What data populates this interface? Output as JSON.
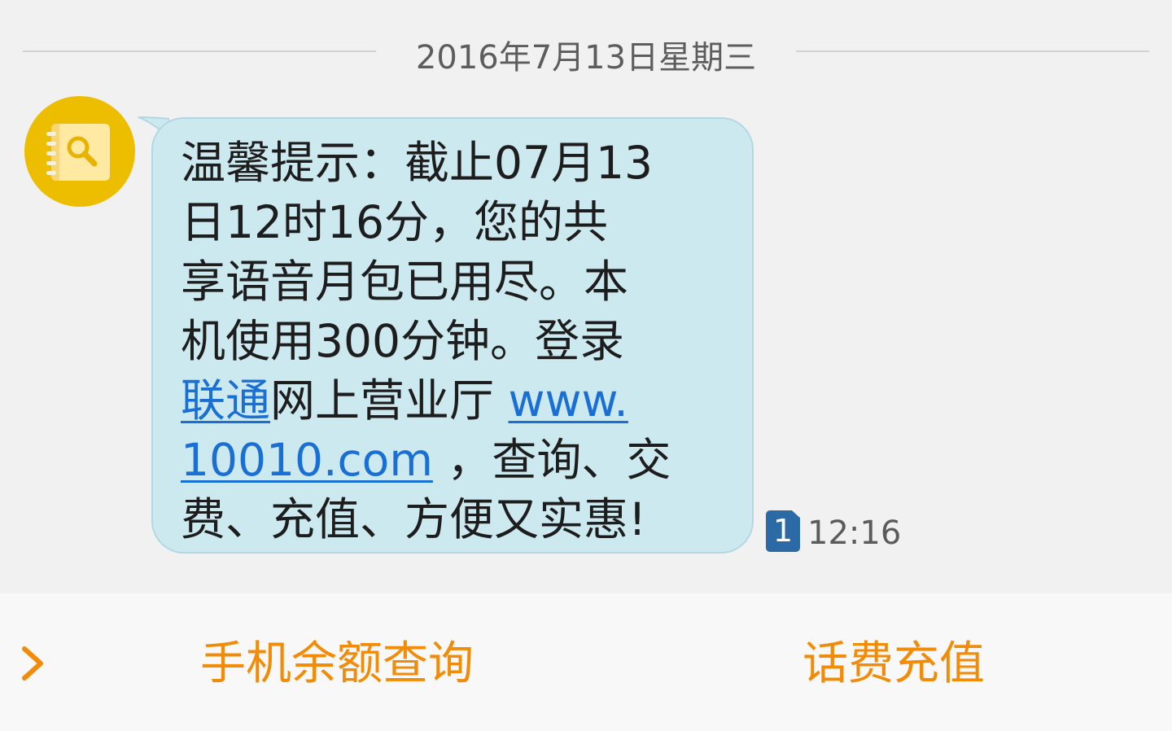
{
  "date_header": "2016年7月13日星期三",
  "sender": {
    "avatar_icon": "contact-book-search-icon",
    "avatar_color": "#edbd00"
  },
  "message": {
    "lines": [
      "温馨提示：截止07月13",
      "日12时16分，您的共",
      "享语音月包已用尽。本",
      "机使用300分钟。登录"
    ],
    "link_text_1": "联通",
    "after_link_1": "网上营业厅 ",
    "link_url_part1": "www.",
    "link_url_part2": "10010.com",
    "after_url": " ，查询、交",
    "last_line": "费、充值、方便又实惠!",
    "bubble_color": "#cde9f0",
    "link_color": "#1a6fd4"
  },
  "sim_slot": "1",
  "time": "12:16",
  "bottom_actions": {
    "expand_icon": "chevron-right-icon",
    "action1": "手机余额查询",
    "action2": "话费充值",
    "accent_color": "#f28c08"
  }
}
